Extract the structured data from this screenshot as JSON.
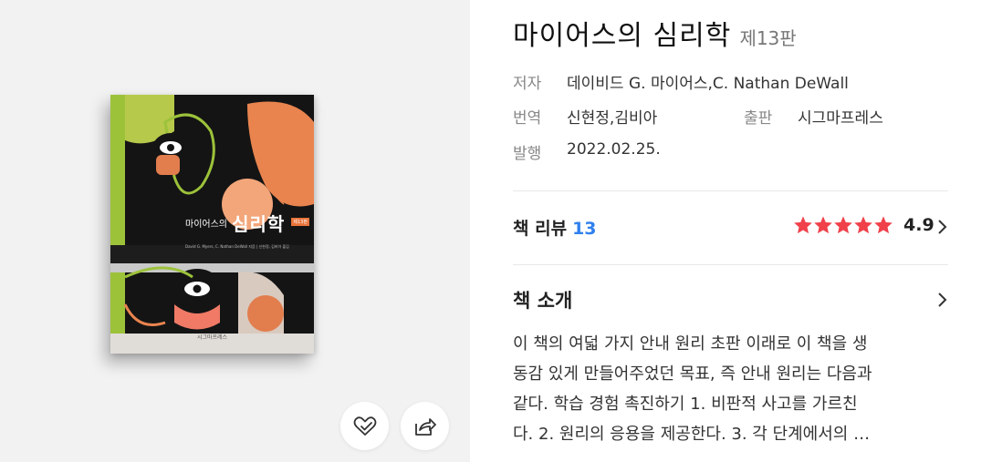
{
  "book": {
    "title": "마이어스의 심리학",
    "edition": "제13판",
    "cover": {
      "small_title": "마이어스의",
      "big_title": "심리학",
      "badge": "제13판",
      "authors": "David G. Myers, C. Nathan DeWall 지음 | 신현정, 김비아 옮김",
      "publisher_mark": "시그마프레스"
    }
  },
  "meta": {
    "author_label": "저자",
    "author_value": "데이비드 G. 마이어스,C. Nathan DeWall",
    "translator_label": "번역",
    "translator_value": "신현정,김비아",
    "publisher_label": "출판",
    "publisher_value": "시그마프레스",
    "published_label": "발행",
    "published_value": "2022.02.25."
  },
  "review": {
    "label": "책 리뷰",
    "count": "13",
    "rating": "4.9",
    "stars": 5,
    "star_color": "#f0414b"
  },
  "intro": {
    "title": "책 소개",
    "lines": [
      "이 책의 여덟 가지 안내 원리 초판 이래로 이 책을 생",
      "동감 있게 만들어주었던 목표, 즉 안내 원리는 다음과",
      "같다. 학습 경험 촉진하기 1. 비판적 사고를 가르친",
      "다. 2. 원리의 응용을 제공한다. 3. 각 단계에서의 …"
    ]
  },
  "actions": {
    "like_icon": "heart-check-icon",
    "share_icon": "share-arrow-icon"
  }
}
